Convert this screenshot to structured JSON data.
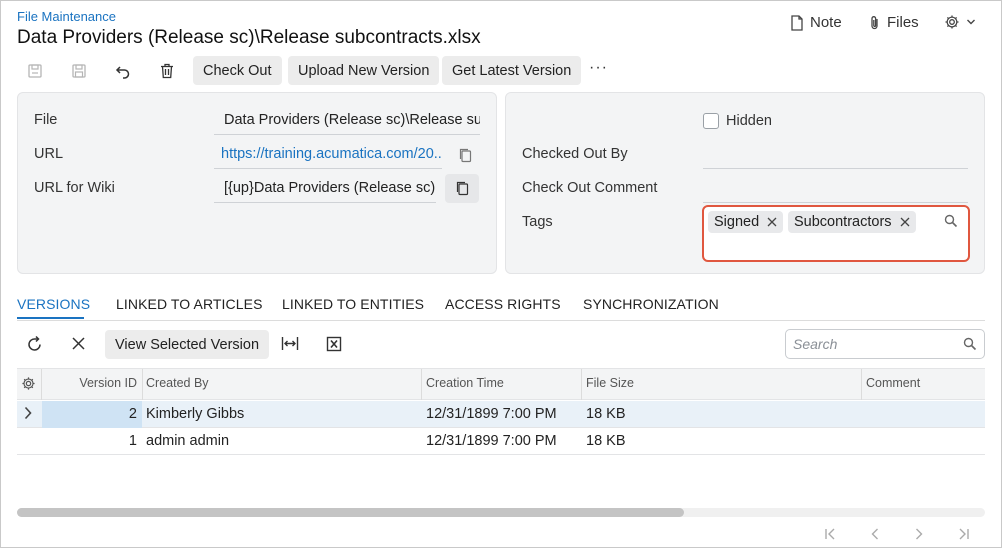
{
  "header": {
    "breadcrumb": "File Maintenance",
    "title": "Data Providers (Release sc)\\Release subcontracts.xlsx",
    "note_label": "Note",
    "files_label": "Files"
  },
  "toolbar": {
    "check_out_label": "Check Out",
    "upload_label": "Upload New Version",
    "get_latest_label": "Get Latest Version",
    "more_label": "···"
  },
  "form_left": {
    "file_label": "File",
    "file_value": "Data Providers (Release sc)\\Release sul",
    "url_label": "URL",
    "url_value": "https://training.acumatica.com/20...",
    "wiki_label": "URL for Wiki",
    "wiki_value": "[{up}Data Providers (Release sc)"
  },
  "form_right": {
    "hidden_label": "Hidden",
    "hidden_checked": false,
    "checked_out_by_label": "Checked Out By",
    "checked_out_by_value": "",
    "comment_label": "Check Out Comment",
    "comment_value": "",
    "tags_label": "Tags",
    "tags": [
      "Signed",
      "Subcontractors"
    ]
  },
  "tabs": [
    "VERSIONS",
    "LINKED TO ARTICLES",
    "LINKED TO ENTITIES",
    "ACCESS RIGHTS",
    "SYNCHRONIZATION"
  ],
  "grid_toolbar": {
    "view_selected_label": "View Selected Version",
    "search_placeholder": "Search"
  },
  "grid": {
    "columns": [
      "Version ID",
      "Created By",
      "Creation Time",
      "File Size",
      "Comment"
    ],
    "rows": [
      {
        "version_id": "2",
        "created_by": "Kimberly Gibbs",
        "creation_time": "12/31/1899 7:00 PM",
        "file_size": "18 KB",
        "comment": ""
      },
      {
        "version_id": "1",
        "created_by": "admin admin",
        "creation_time": "12/31/1899 7:00 PM",
        "file_size": "18 KB",
        "comment": ""
      }
    ]
  },
  "colors": {
    "accent": "#1a73c1",
    "tag_border": "#e0573f",
    "selected_row": "#e9f1f8"
  }
}
